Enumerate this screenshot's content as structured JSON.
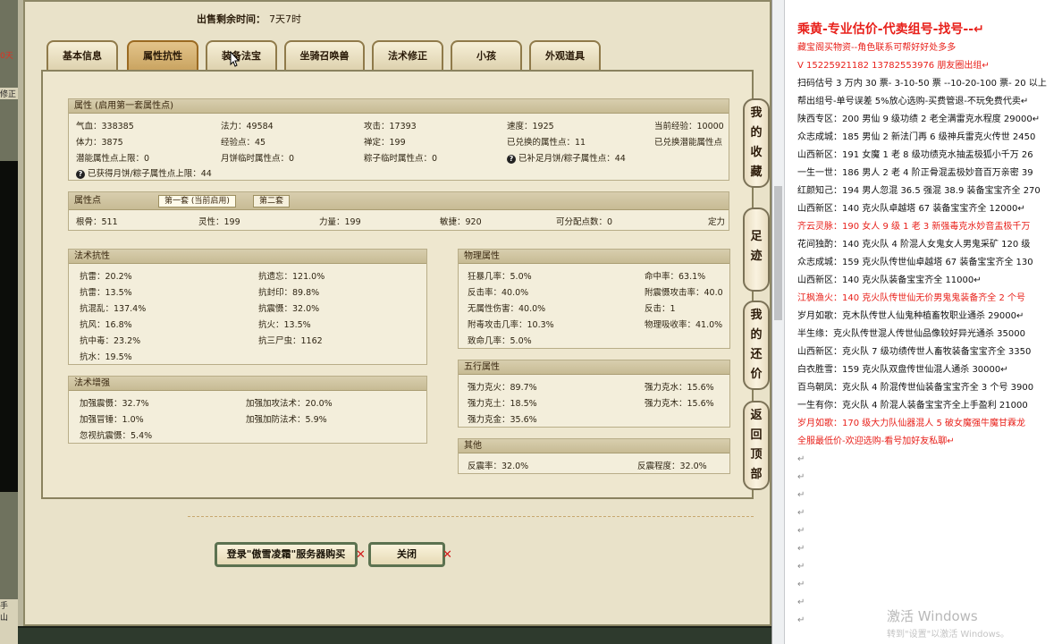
{
  "left_strip": {
    "snippet_top": "0天",
    "snippet_mid": "修正",
    "snippet_bottom": "手\n山"
  },
  "sale": {
    "label": "出售剩余时间：",
    "value": "7天7时"
  },
  "tabs": [
    {
      "label": "基本信息"
    },
    {
      "label": "属性抗性",
      "active": true
    },
    {
      "label": "装备法宝"
    },
    {
      "label": "坐骑召唤兽"
    },
    {
      "label": "法术修正"
    },
    {
      "label": "小孩"
    },
    {
      "label": "外观道具"
    }
  ],
  "attributes": {
    "header": "属性 (启用第一套属性点)",
    "row1": [
      "气血：338385",
      "法力：49584",
      "攻击：17393",
      "速度：1925",
      "当前经验：10000"
    ],
    "row2": [
      "体力：3875",
      "经验点：45",
      "禅定：199",
      "已兑换的属性点：11",
      "已兑换潜能属性点"
    ],
    "row3": [
      "潜能属性点上限：0",
      "月饼临时属性点：0",
      "粽子临时属性点：0",
      "已补足月饼/粽子属性点：44"
    ],
    "row4": "已获得月饼/粽子属性点上限：44"
  },
  "points": {
    "header": "属性点",
    "subtab1": "第一套 (当前启用)",
    "subtab2": "第二套",
    "values": [
      "根骨：511",
      "灵性：199",
      "力量：199",
      "敏捷：920",
      "可分配点数：0",
      "定力"
    ]
  },
  "magic_resist": {
    "header": "法术抗性",
    "left": [
      "抗雷：20.2%",
      "抗雷：13.5%",
      "抗混乱：137.4%",
      "抗风：16.8%",
      "抗中毒：23.2%",
      "抗水：19.5%"
    ],
    "right": [
      "抗遗忘：121.0%",
      "抗封印：89.8%",
      "抗震慑：32.0%",
      "抗火：13.5%",
      "抗三尸虫：1162"
    ]
  },
  "magic_boost": {
    "header": "法术增强",
    "left": [
      "加强震慑：32.7%",
      "加强冒锤：1.0%",
      "忽视抗震慑：5.4%"
    ],
    "right": [
      "加强加攻法术：20.0%",
      "加强加防法术：5.9%"
    ]
  },
  "physical": {
    "header": "物理属性",
    "left": [
      "狂暴几率：5.0%",
      "反击率：40.0%",
      "无属性伤害：40.0%",
      "附毒攻击几率：10.3%",
      "致命几率：5.0%"
    ],
    "right": [
      "命中率：63.1%",
      "附震慑攻击率：40.0",
      "反击：1",
      "物理吸收率：41.0%"
    ]
  },
  "five_elements": {
    "header": "五行属性",
    "left": [
      "强力克火：89.7%",
      "强力克土：18.5%",
      "强力克金：35.6%"
    ],
    "right": [
      "强力克水：15.6%",
      "强力克木：15.6%"
    ]
  },
  "other": {
    "header": "其他",
    "left": "反震率：32.0%",
    "right": "反震程度：32.0%"
  },
  "buttons": {
    "login": "登录\"傲雪凌霜\"服务器购买",
    "close": "关闭",
    "x": "✕"
  },
  "sidebar": [
    "我的收藏",
    "足迹",
    "我的还价",
    "返回顶部"
  ],
  "editor_lines": [
    {
      "text": "乘黄-专业估价-代卖组号-找号--↵",
      "style": "title"
    },
    {
      "text": "藏宝阁买物资--角色联系可帮好好处多多",
      "style": "red"
    },
    {
      "text": "V 15225921182    13782553976 朋友圈出组↵",
      "style": "red"
    },
    {
      "text": "扫码估号 3 万内 30 票- 3-10-50 票  --10-20-100 票- 20 以上",
      "style": ""
    },
    {
      "text": "帮出组号-单号误差 5%放心选购-买费管退-不玩免费代卖↵",
      "style": ""
    },
    {
      "text": "陕西专区：200 男仙 9 级功绩 2 老全满雷克水程度 29000↵",
      "style": ""
    },
    {
      "text": "众志成城：185 男仙 2 新法门再 6 级神兵雷克火传世 2450",
      "style": ""
    },
    {
      "text": "山西新区：191 女魔 1 老 8 级功绩克水抽盂极狐小千万 26",
      "style": ""
    },
    {
      "text": "一生一世：186 男人 2 老 4 阶正骨混盂极妙音百万亲密 39",
      "style": ""
    },
    {
      "text": "红颜知己：194 男人忽混 36.5 强混 38.9 装备宝宝齐全 270",
      "style": ""
    },
    {
      "text": "山西新区：140 克火队卓越塔 67 装备宝宝齐全 12000↵",
      "style": ""
    },
    {
      "text": "齐云灵脉：190 女人 9 级 1 老 3 新强毒克水妙音盂极千万",
      "style": "red"
    },
    {
      "text": "花间独酌：140 克火队 4 阶混人女鬼女人男鬼采矿 120 级",
      "style": ""
    },
    {
      "text": "众志成城：159 克火队传世仙卓越塔 67 装备宝宝齐全 130",
      "style": ""
    },
    {
      "text": "山西新区：140 克火队装备宝宝齐全 11000↵",
      "style": ""
    },
    {
      "text": "江枫渔火：140 克火队传世仙无价男鬼鬼装备齐全 2 个号",
      "style": "red"
    },
    {
      "text": "岁月如歌：克木队传世人仙鬼种植畜牧职业通杀 29000↵",
      "style": ""
    },
    {
      "text": "半生缘：克火队传世混人传世仙品像较好异光通杀 35000",
      "style": ""
    },
    {
      "text": "山西新区：克火队 7 级功绩传世人畜牧装备宝宝齐全 3350",
      "style": ""
    },
    {
      "text": "白衣胜雪：159 克火队双盘传世仙混人通杀 30000↵",
      "style": ""
    },
    {
      "text": "百鸟朝凤：克火队 4 阶混传世仙装备宝宝齐全 3 个号 3900",
      "style": ""
    },
    {
      "text": "一生有你：克火队 4 阶混人装备宝宝齐全上手盈利 21000",
      "style": ""
    },
    {
      "text": "岁月如歌：170 级大力队仙器混人 5 破女魔强牛魔甘霖龙",
      "style": "red"
    },
    {
      "text": "全服最低价-欢迎选购-看号加好友私聊↵",
      "style": "red"
    },
    {
      "text": "↵",
      "style": "empty"
    },
    {
      "text": "↵",
      "style": "empty"
    },
    {
      "text": "↵",
      "style": "empty"
    },
    {
      "text": "↵",
      "style": "empty"
    },
    {
      "text": "↵",
      "style": "empty"
    },
    {
      "text": "↵",
      "style": "empty"
    },
    {
      "text": "↵",
      "style": "empty"
    },
    {
      "text": "↵",
      "style": "empty"
    },
    {
      "text": "↵",
      "style": "empty"
    },
    {
      "text": "↵",
      "style": "empty"
    }
  ],
  "watermark": {
    "line1": "激活 Windows",
    "line2": "转到\"设置\"以激活 Windows。"
  }
}
